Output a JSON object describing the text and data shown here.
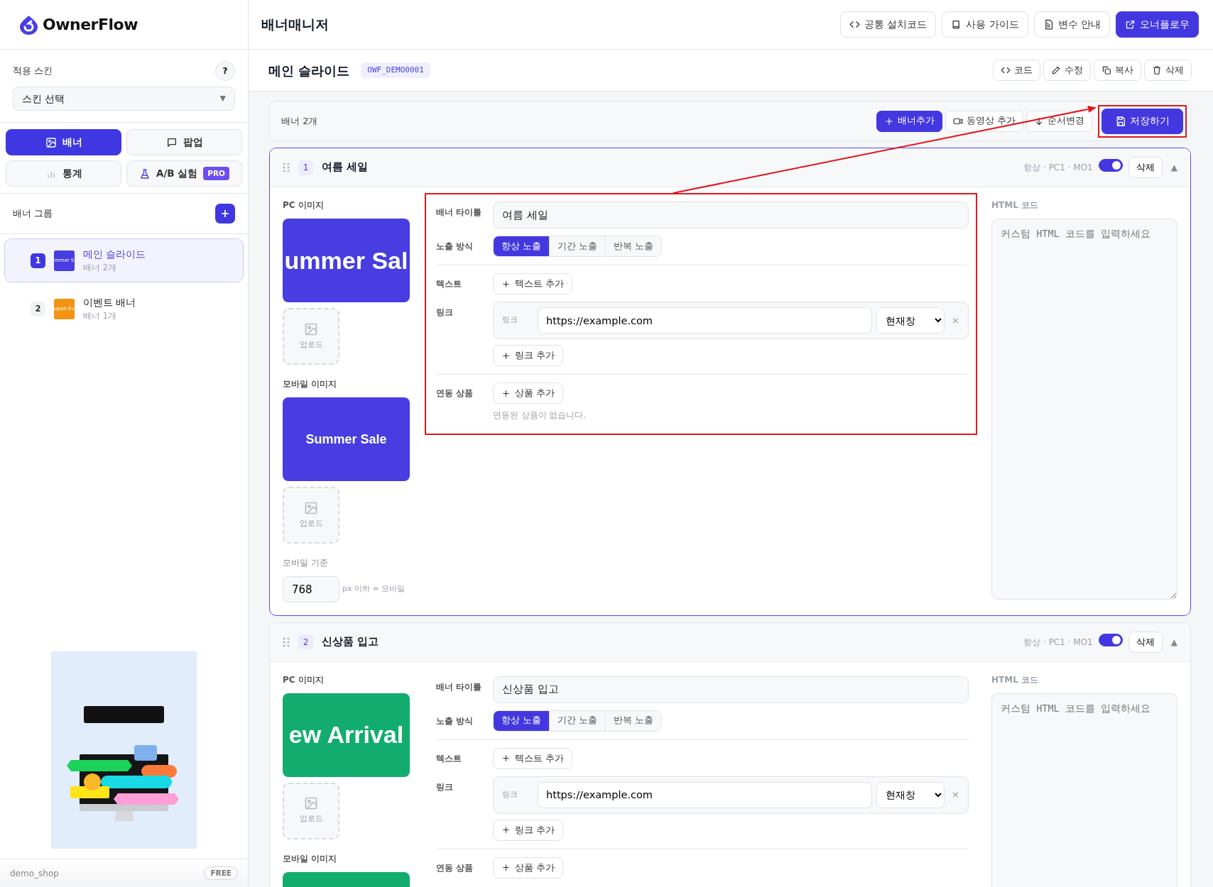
{
  "brand": {
    "name": "OwnerFlow"
  },
  "sidebar": {
    "skin": {
      "label": "적용 스킨",
      "help": "?",
      "select": "스킨 선택",
      "caret": "▼"
    },
    "tabs": [
      {
        "label": "배너",
        "selected": true
      },
      {
        "label": "팝업",
        "selected": false
      },
      {
        "label": "통계",
        "selected": false
      },
      {
        "label": "A/B 실험",
        "selected": false,
        "badge": "PRO"
      }
    ],
    "group_title": "배너 그룹",
    "add": "+",
    "groups": [
      {
        "number": "1",
        "thumb": "mmer S",
        "color": "#473de0",
        "name": "메인 슬라이드",
        "count": "배너 2개",
        "selected": true
      },
      {
        "number": "2",
        "thumb": "upon Ev",
        "color": "#f29412",
        "name": "이벤트 배너",
        "count": "배너 1개",
        "selected": false
      }
    ],
    "footer": {
      "shop": "demo_shop",
      "plan": "FREE"
    }
  },
  "header": {
    "title": "배너매니저",
    "buttons": [
      {
        "label": "공통 설치코드",
        "primary": false
      },
      {
        "label": "사용 가이드",
        "primary": false
      },
      {
        "label": "변수 안내",
        "primary": false
      },
      {
        "label": "오너플로우",
        "primary": true
      }
    ]
  },
  "group": {
    "name": "메인 슬라이드",
    "code": "OWF_DEMO0001",
    "actions": [
      "코드",
      "수정",
      "복사",
      "삭제"
    ]
  },
  "toolbar": {
    "count": "배너 2개",
    "buttons": [
      {
        "label": "배너추가",
        "primary": true,
        "highlighted": false
      },
      {
        "label": "동영상 추가",
        "primary": false,
        "highlighted": false
      },
      {
        "label": "순서변경",
        "primary": false,
        "highlighted": false
      },
      {
        "label": "저장하기",
        "primary": true,
        "highlighted": true
      }
    ]
  },
  "annotation": {
    "arrow": true
  },
  "banners": [
    {
      "number": "1",
      "title": "여름 세일",
      "summary": "항상 · PC1 · MO1",
      "on": true,
      "delete": "삭제",
      "toggle": "▲",
      "expanded": true,
      "highlighted": true,
      "pc": {
        "label": "PC 이미지",
        "preview": "ummer Sal",
        "color": "#473de0",
        "upload": "업로드"
      },
      "mobile": {
        "label": "모바일 이미지",
        "preview": "Summer Sale",
        "color": "#473de0",
        "upload": "업로드"
      },
      "breakpoint": {
        "label": "모바일 기준",
        "value": "768",
        "hint": "px 이하 = 모바일"
      },
      "form": {
        "title_label": "배너 타이틀",
        "title_value": "여름 세일",
        "mode_label": "노출 방식",
        "modes": [
          {
            "label": "항상 노출",
            "selected": true
          },
          {
            "label": "기간 노출",
            "selected": false
          },
          {
            "label": "반복 노출",
            "selected": false
          }
        ],
        "text_label": "텍스트",
        "add_text": "텍스트 추가",
        "link_label": "링크",
        "links": [
          {
            "label": "링크",
            "url": "https://example.com",
            "target": "현재창",
            "remove": "×"
          }
        ],
        "add_link": "링크 추가",
        "products_label": "연동 상품",
        "add_product": "상품 추가",
        "empty": "연동된 상품이 없습니다."
      },
      "html": {
        "label": "HTML 코드",
        "placeholder": "커스텀 HTML 코드를 입력하세요"
      }
    },
    {
      "number": "2",
      "title": "신상품 입고",
      "summary": "항상 · PC1 · MO1",
      "on": true,
      "delete": "삭제",
      "toggle": "▲",
      "expanded": true,
      "highlighted": false,
      "pc": {
        "label": "PC 이미지",
        "preview": "ew Arrival",
        "color": "#12ad6e",
        "upload": "업로드"
      },
      "mobile": {
        "label": "모바일 이미지",
        "color": "#12ad6e"
      },
      "form": {
        "title_label": "배너 타이틀",
        "title_value": "신상품 입고",
        "mode_label": "노출 방식",
        "modes": [
          {
            "label": "항상 노출",
            "selected": true
          },
          {
            "label": "기간 노출",
            "selected": false
          },
          {
            "label": "반복 노출",
            "selected": false
          }
        ],
        "text_label": "텍스트",
        "add_text": "텍스트 추가",
        "link_label": "링크",
        "links": [
          {
            "label": "링크",
            "url": "https://example.com",
            "target": "현재창",
            "remove": "×"
          }
        ],
        "add_link": "링크 추가",
        "products_label": "연동 상품",
        "add_product": "상품 추가"
      },
      "html": {
        "label": "HTML 코드",
        "placeholder": "커스텀 HTML 코드를 입력하세요"
      }
    }
  ]
}
